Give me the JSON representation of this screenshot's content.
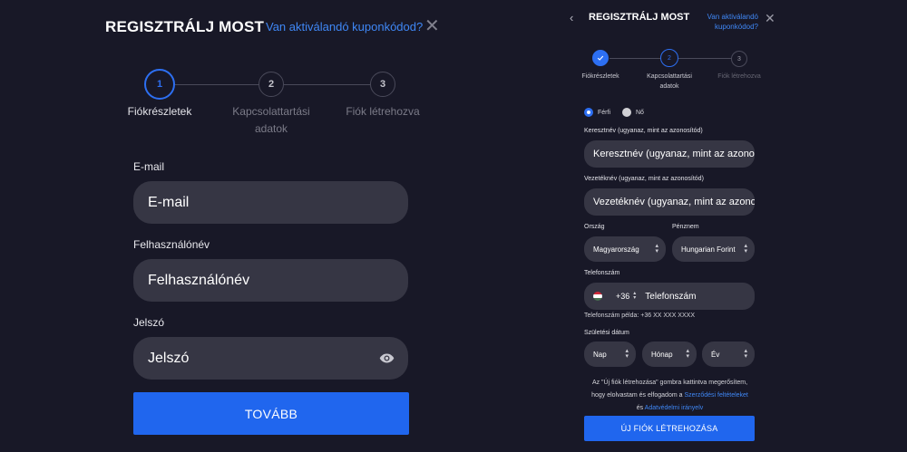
{
  "left": {
    "title": "REGISZTRÁLJ MOST",
    "coupon_link": "Van aktiválandó kuponkódod?",
    "close_icon": "close-icon",
    "steps": [
      {
        "number": "1",
        "label": "Fiókrészletek",
        "state": "active"
      },
      {
        "number": "2",
        "label_line1": "Kapcsolattartási",
        "label_line2": "adatok",
        "state": "pending"
      },
      {
        "number": "3",
        "label": "Fiók létrehozva",
        "state": "pending"
      }
    ],
    "fields": {
      "email_label": "E-mail",
      "email_placeholder": "E-mail",
      "username_label": "Felhasználónév",
      "username_placeholder": "Felhasználónév",
      "password_label": "Jelszó",
      "password_placeholder": "Jelszó",
      "password_toggle_icon": "eye-icon"
    },
    "submit_label": "TOVÁBB"
  },
  "right": {
    "back_icon": "chevron-left-icon",
    "title": "REGISZTRÁLJ MOST",
    "coupon_link_line1": "Van aktiválandó",
    "coupon_link_line2": "kuponkódod?",
    "steps": [
      {
        "number": "",
        "label": "Fiókrészletek",
        "state": "done",
        "icon": "check-icon"
      },
      {
        "number": "2",
        "label_line1": "Kapcsolattartási",
        "label_line2": "adatok",
        "state": "active"
      },
      {
        "number": "3",
        "label": "Fiók létrehozva",
        "state": "pending"
      }
    ],
    "gender": {
      "male": "Férfi",
      "female": "Nő",
      "selected": "male"
    },
    "first_name_label": "Keresztnév (ugyanaz, mint az azonosítód)",
    "first_name_placeholder": "Keresztnév (ugyanaz, mint az azonosítód)",
    "last_name_label": "Vezetéknév (ugyanaz, mint az azonosítód)",
    "last_name_placeholder": "Vezetéknév (ugyanaz, mint az azonosítód)",
    "country_label": "Ország",
    "country_value": "Magyarország",
    "currency_label": "Pénznem",
    "currency_value": "Hungarian Forint",
    "phone_label": "Telefonszám",
    "phone_code": "+36",
    "phone_placeholder": "Telefonszám",
    "phone_hint": "Telefonszám példa: +36 XX XXX XXXX",
    "birth_label": "Születési dátum",
    "birth_day": "Nap",
    "birth_month": "Hónap",
    "birth_year": "Év",
    "consent_line1": "Az \"Új fiók létrehozása\" gombra kattintva megerősítem,",
    "consent_line2_pre": "hogy elolvastam és elfogadom a ",
    "consent_terms_link": "Szerződési feltételeket",
    "consent_line3_pre": "és ",
    "consent_privacy_link": "Adatvédelmi irányelv",
    "submit_label": "ÚJ FIÓK LÉTREHOZÁSA"
  },
  "colors": {
    "accent": "#2066ee",
    "link": "#3f87f5",
    "panel_bg": "#181827",
    "input_bg": "#363644"
  }
}
